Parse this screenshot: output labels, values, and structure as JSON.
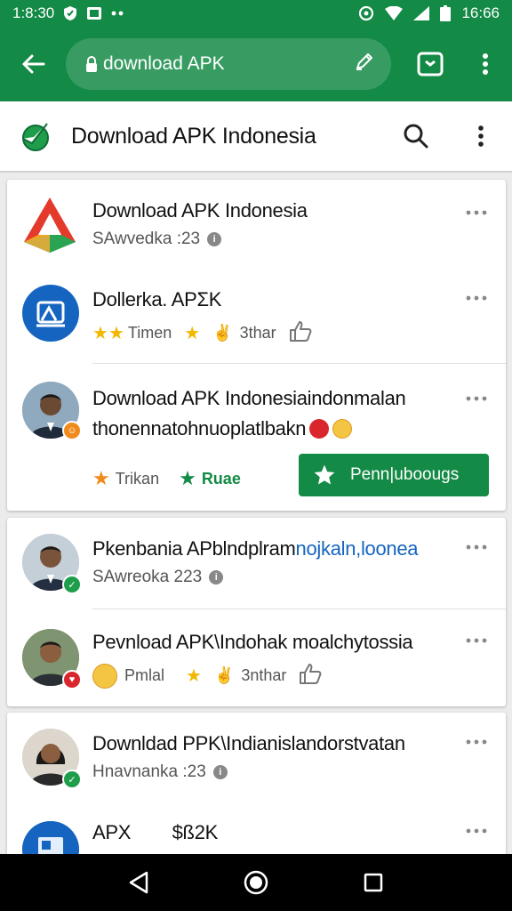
{
  "status_bar": {
    "time_left": "1:8:30",
    "time_right": "16:66"
  },
  "browser": {
    "url": "download APK"
  },
  "app": {
    "title": "Download APK Indonesia"
  },
  "items": [
    {
      "title": "Download APK Indonesia",
      "subtitle": "SAwvedka :23"
    },
    {
      "title": "Dollerka. APΣK",
      "meta1": "Timen",
      "meta2": "3thar"
    },
    {
      "title_line1": "Download APK Indonesiaindonmalan",
      "title_line2": "thonennatohnuoplatlbakn",
      "meta1": "Trikan",
      "meta2": "Ruae",
      "button": "Penn|uboougs"
    },
    {
      "title_prefix": "Pkenbania APblndplram",
      "title_link": "nojkaln,loonea",
      "subtitle": "SAwreoka 223"
    },
    {
      "title": "Pevnload APK\\Indohak moalchytossia",
      "meta1": "Pmlal",
      "meta2": "3nthar"
    },
    {
      "title": "Downldad PPK\\Indianislandorstvatan",
      "subtitle": "Hnavnanka :23"
    },
    {
      "title": "APX        $ß2K"
    }
  ],
  "colors": {
    "brand_green": "#138a45",
    "star_yellow": "#f2b800",
    "star_orange": "#f08a1a",
    "badge_green": "#1e9e4a",
    "badge_red": "#d8262c",
    "link_blue": "#1565c0"
  }
}
